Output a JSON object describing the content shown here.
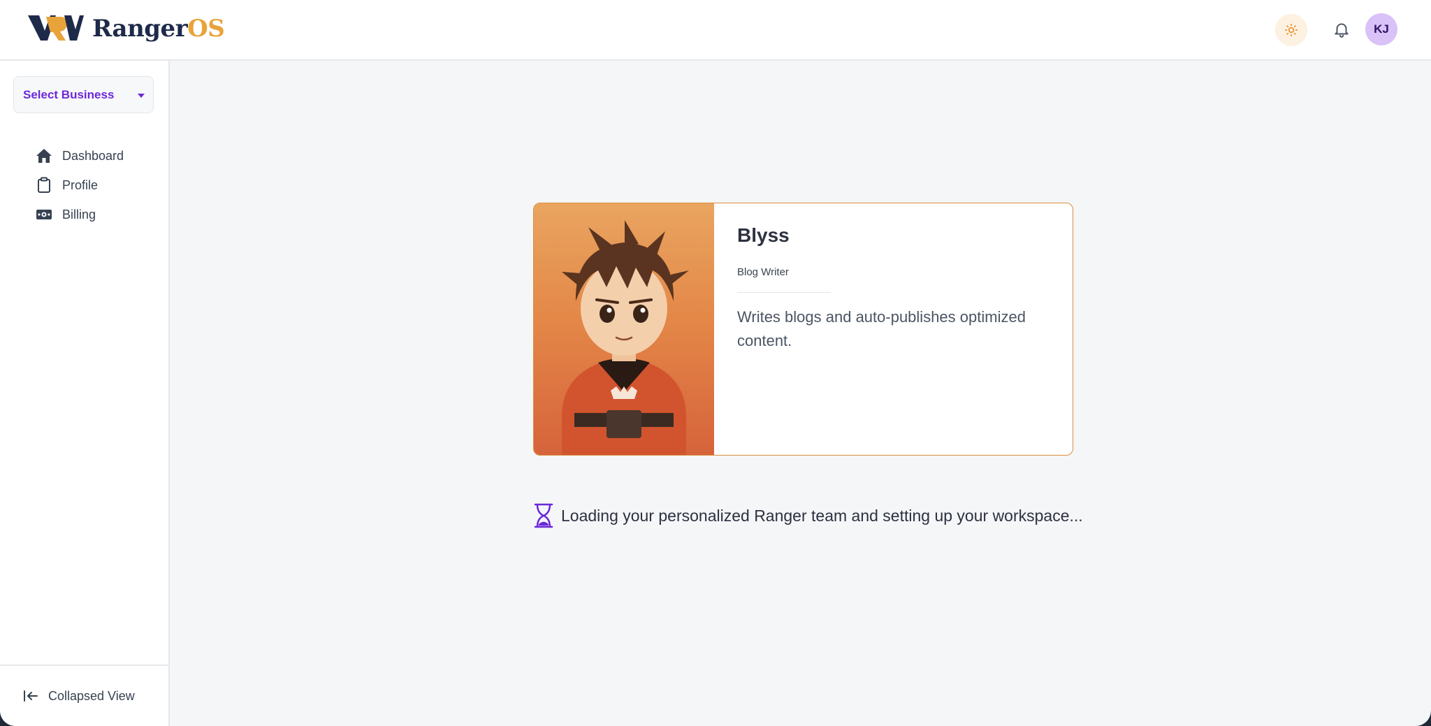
{
  "brand": {
    "name_part1": "Ranger",
    "name_part2": "OS"
  },
  "header": {
    "avatar_initials": "KJ",
    "icons": [
      "sun-icon",
      "bell-icon"
    ]
  },
  "sidebar": {
    "business_select": {
      "label": "Select Business"
    },
    "items": [
      {
        "label": "Dashboard",
        "icon": "home-icon"
      },
      {
        "label": "Profile",
        "icon": "clipboard-icon"
      },
      {
        "label": "Billing",
        "icon": "money-icon"
      }
    ],
    "collapse_label": "Collapsed View"
  },
  "agent_card": {
    "name": "Blyss",
    "role": "Blog Writer",
    "description": "Writes blogs and auto-publishes optimized content."
  },
  "status": {
    "loading_text": "Loading your personalized Ranger team and setting up your workspace..."
  },
  "colors": {
    "accent": "#6d28d9",
    "brand_gold": "#e8a33a",
    "brand_navy": "#1e2a4a",
    "card_border": "#d88f3c",
    "avatar_bg": "#d9c2f7"
  }
}
